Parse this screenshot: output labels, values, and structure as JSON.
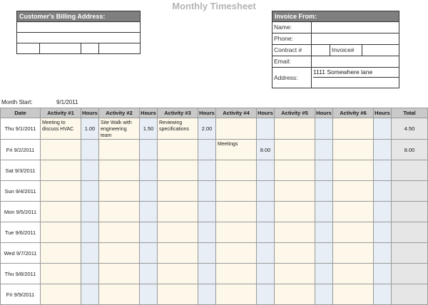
{
  "title": "Monthly Timesheet",
  "billing": {
    "header": "Customer's Billing Address:"
  },
  "invoice": {
    "header": "Invoice From:",
    "name_label": "Name:",
    "phone_label": "Phone:",
    "contract_label": "Contract #",
    "invoice_label": "Invoice#",
    "email_label": "Email:",
    "address_label": "Address:",
    "address_value": "1111 Somewhere lane"
  },
  "month_start": {
    "label": "Month Start:",
    "value": "9/1/2011"
  },
  "table": {
    "headers": [
      "Date",
      "Activity #1",
      "Hours",
      "Activity #2",
      "Hours",
      "Activity #3",
      "Hours",
      "Activity #4",
      "Hours",
      "Activity #5",
      "Hours",
      "Activity #6",
      "Hours",
      "Total"
    ],
    "rows": [
      {
        "date": "Thu 9/1/2011",
        "a1": "Meeting to discuss HVAC",
        "h1": "1.00",
        "a2": "Site Walk with engineering team",
        "h2": "1.50",
        "a3": "Reviewing specifications",
        "h3": "2.00",
        "a4": "",
        "h4": "",
        "a5": "",
        "h5": "",
        "a6": "",
        "h6": "",
        "total": "4.50"
      },
      {
        "date": "Fri 9/2/2011",
        "a1": "",
        "h1": "",
        "a2": "",
        "h2": "",
        "a3": "",
        "h3": "",
        "a4": "Meetings",
        "h4": "8.00",
        "a5": "",
        "h5": "",
        "a6": "",
        "h6": "",
        "total": "8.00"
      },
      {
        "date": "Sat 9/3/2011",
        "a1": "",
        "h1": "",
        "a2": "",
        "h2": "",
        "a3": "",
        "h3": "",
        "a4": "",
        "h4": "",
        "a5": "",
        "h5": "",
        "a6": "",
        "h6": "",
        "total": ""
      },
      {
        "date": "Sun 9/4/2011",
        "a1": "",
        "h1": "",
        "a2": "",
        "h2": "",
        "a3": "",
        "h3": "",
        "a4": "",
        "h4": "",
        "a5": "",
        "h5": "",
        "a6": "",
        "h6": "",
        "total": ""
      },
      {
        "date": "Mon 9/5/2011",
        "a1": "",
        "h1": "",
        "a2": "",
        "h2": "",
        "a3": "",
        "h3": "",
        "a4": "",
        "h4": "",
        "a5": "",
        "h5": "",
        "a6": "",
        "h6": "",
        "total": ""
      },
      {
        "date": "Tue 9/6/2011",
        "a1": "",
        "h1": "",
        "a2": "",
        "h2": "",
        "a3": "",
        "h3": "",
        "a4": "",
        "h4": "",
        "a5": "",
        "h5": "",
        "a6": "",
        "h6": "",
        "total": ""
      },
      {
        "date": "Wed 9/7/2011",
        "a1": "",
        "h1": "",
        "a2": "",
        "h2": "",
        "a3": "",
        "h3": "",
        "a4": "",
        "h4": "",
        "a5": "",
        "h5": "",
        "a6": "",
        "h6": "",
        "total": ""
      },
      {
        "date": "Thu 9/8/2011",
        "a1": "",
        "h1": "",
        "a2": "",
        "h2": "",
        "a3": "",
        "h3": "",
        "a4": "",
        "h4": "",
        "a5": "",
        "h5": "",
        "a6": "",
        "h6": "",
        "total": ""
      },
      {
        "date": "Fri 9/9/2011",
        "a1": "",
        "h1": "",
        "a2": "",
        "h2": "",
        "a3": "",
        "h3": "",
        "a4": "",
        "h4": "",
        "a5": "",
        "h5": "",
        "a6": "",
        "h6": "",
        "total": ""
      }
    ]
  }
}
